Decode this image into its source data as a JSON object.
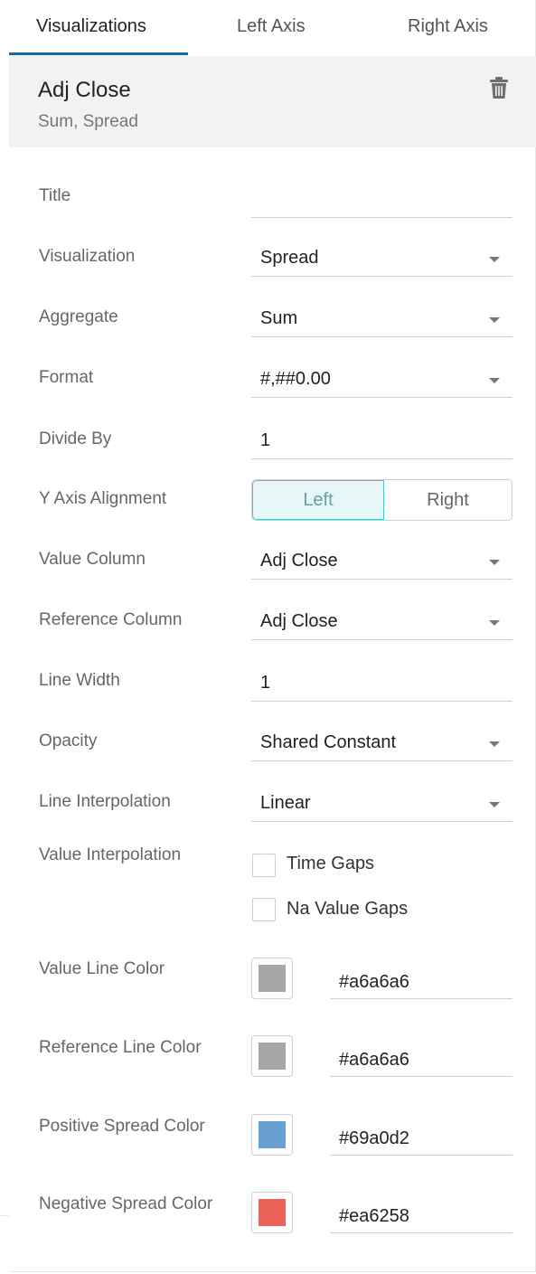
{
  "tabs": [
    {
      "label": "Visualizations",
      "active": true
    },
    {
      "label": "Left Axis",
      "active": false
    },
    {
      "label": "Right Axis",
      "active": false
    }
  ],
  "header": {
    "title": "Adj Close",
    "subtitle": "Sum, Spread",
    "delete_icon": "trash-icon"
  },
  "fields": {
    "title": {
      "label": "Title",
      "value": ""
    },
    "visualization": {
      "label": "Visualization",
      "value": "Spread"
    },
    "aggregate": {
      "label": "Aggregate",
      "value": "Sum"
    },
    "format": {
      "label": "Format",
      "value": "#,##0.00"
    },
    "divide_by": {
      "label": "Divide By",
      "value": "1"
    },
    "y_axis_alignment": {
      "label": "Y Axis Alignment",
      "options": [
        "Left",
        "Right"
      ],
      "selected": "Left"
    },
    "value_column": {
      "label": "Value Column",
      "value": "Adj Close"
    },
    "reference_column": {
      "label": "Reference Column",
      "value": "Adj Close"
    },
    "line_width": {
      "label": "Line Width",
      "value": "1"
    },
    "opacity": {
      "label": "Opacity",
      "value": "Shared Constant"
    },
    "line_interpolation": {
      "label": "Line Interpolation",
      "value": "Linear"
    },
    "value_interpolation": {
      "label": "Value Interpolation",
      "options": [
        {
          "label": "Time Gaps",
          "checked": false
        },
        {
          "label": "Na Value Gaps",
          "checked": false
        }
      ]
    }
  },
  "colors": {
    "value_line": {
      "label": "Value Line Color",
      "hex": "#a6a6a6"
    },
    "reference_line": {
      "label": "Reference Line Color",
      "hex": "#a6a6a6"
    },
    "positive_spread": {
      "label": "Positive Spread Color",
      "hex": "#69a0d2"
    },
    "negative_spread": {
      "label": "Negative Spread Color",
      "hex": "#ea6258"
    }
  },
  "theme": {
    "accent": "#1f6b8f",
    "toggle_border": "#4cc4c4",
    "toggle_bg": "#e7f7f7"
  }
}
